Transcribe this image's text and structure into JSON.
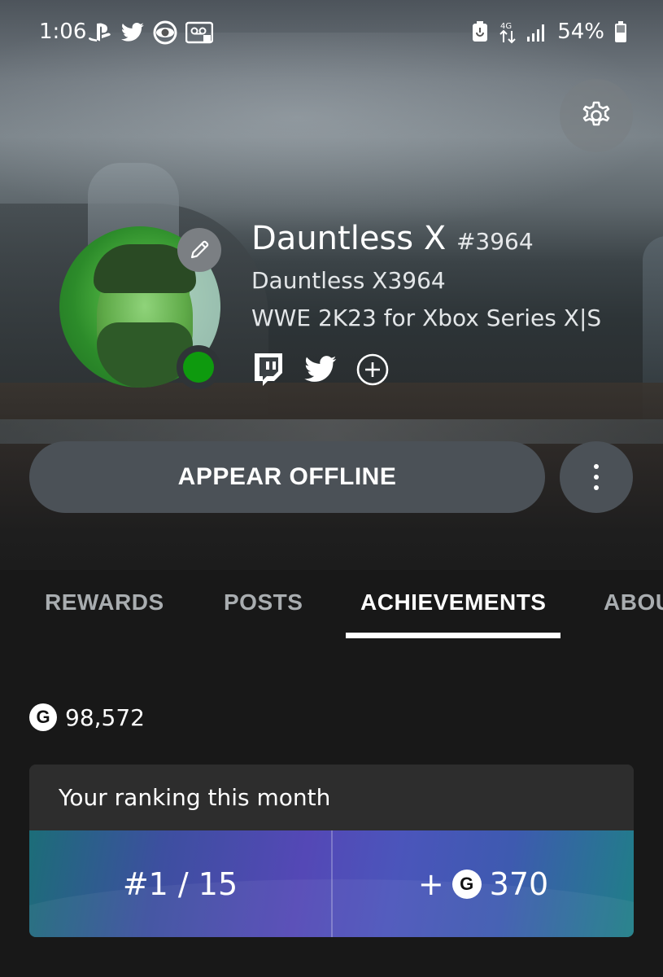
{
  "status_bar": {
    "time": "1:06",
    "battery_percent": "54%",
    "left_icons": [
      "playstation-icon",
      "twitter-icon",
      "cbs-eye-icon",
      "voicemail-icon"
    ],
    "right_icons": [
      "battery-saver-icon",
      "data-transfer-icon",
      "signal-icon",
      "battery-icon"
    ]
  },
  "profile": {
    "gamertag": "Dauntless X",
    "gamertag_suffix": "#3964",
    "real_name": "Dauntless X3964",
    "presence": "WWE 2K23 for Xbox Series X|S",
    "online_status": "online",
    "socials": [
      "twitch-icon",
      "twitter-icon",
      "add-circle-icon"
    ]
  },
  "actions": {
    "primary_label": "APPEAR OFFLINE"
  },
  "tabs": [
    {
      "label": "REWARDS",
      "active": false
    },
    {
      "label": "POSTS",
      "active": false
    },
    {
      "label": "ACHIEVEMENTS",
      "active": true
    },
    {
      "label": "ABOUT",
      "active": false
    }
  ],
  "achievements": {
    "gamerscore_badge": "G",
    "gamerscore": "98,572",
    "ranking": {
      "title": "Your ranking this month",
      "rank": "#1 / 15",
      "points_prefix": "+",
      "points": "370"
    }
  },
  "colors": {
    "background": "#181818",
    "button": "#4b5157",
    "online": "#0e9a0e",
    "rank_gradient_start": "#1c6d78",
    "rank_gradient_mid": "#5448b6"
  }
}
